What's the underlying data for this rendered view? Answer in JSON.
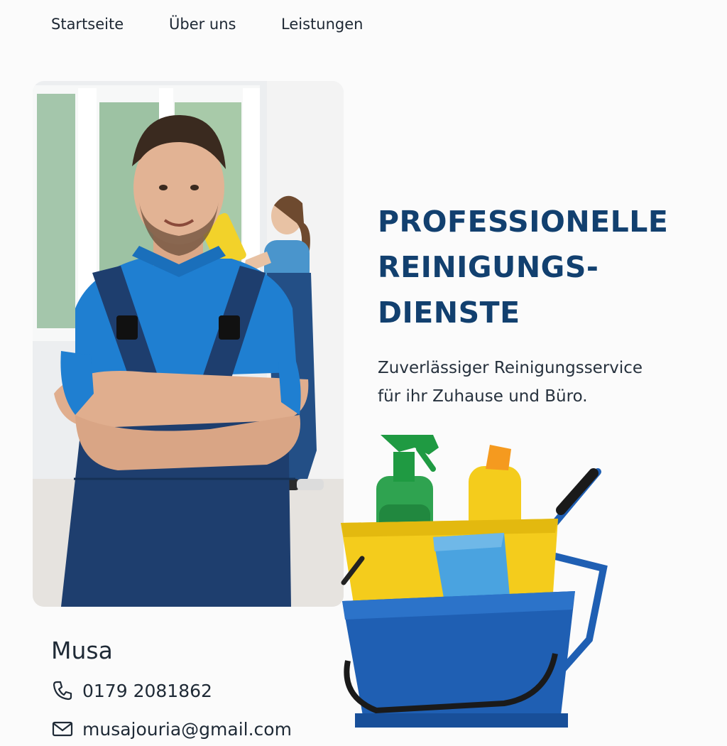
{
  "nav": {
    "items": [
      {
        "label": "Startseite"
      },
      {
        "label": "Über uns"
      },
      {
        "label": "Leistungen"
      }
    ]
  },
  "hero": {
    "title_lines": [
      "PROFESSIONELLE",
      "REINIGUNGS-",
      "DIENSTE"
    ],
    "subtitle_lines": [
      "Zuverlässiger Reinigungsservice",
      "für ihr Zuhause und Büro."
    ]
  },
  "contact": {
    "name": "Musa",
    "phone": "0179 2081862",
    "email": "musajouria@gmail.com"
  },
  "icons": {
    "phone": "phone-icon",
    "email": "mail-icon"
  },
  "colors": {
    "title": "#12406f",
    "uniform_shirt": "#1f7fd1",
    "overalls": "#1e3e6e",
    "bucket_blue": "#1f5fb3",
    "tray_yellow": "#f4cc1c"
  }
}
